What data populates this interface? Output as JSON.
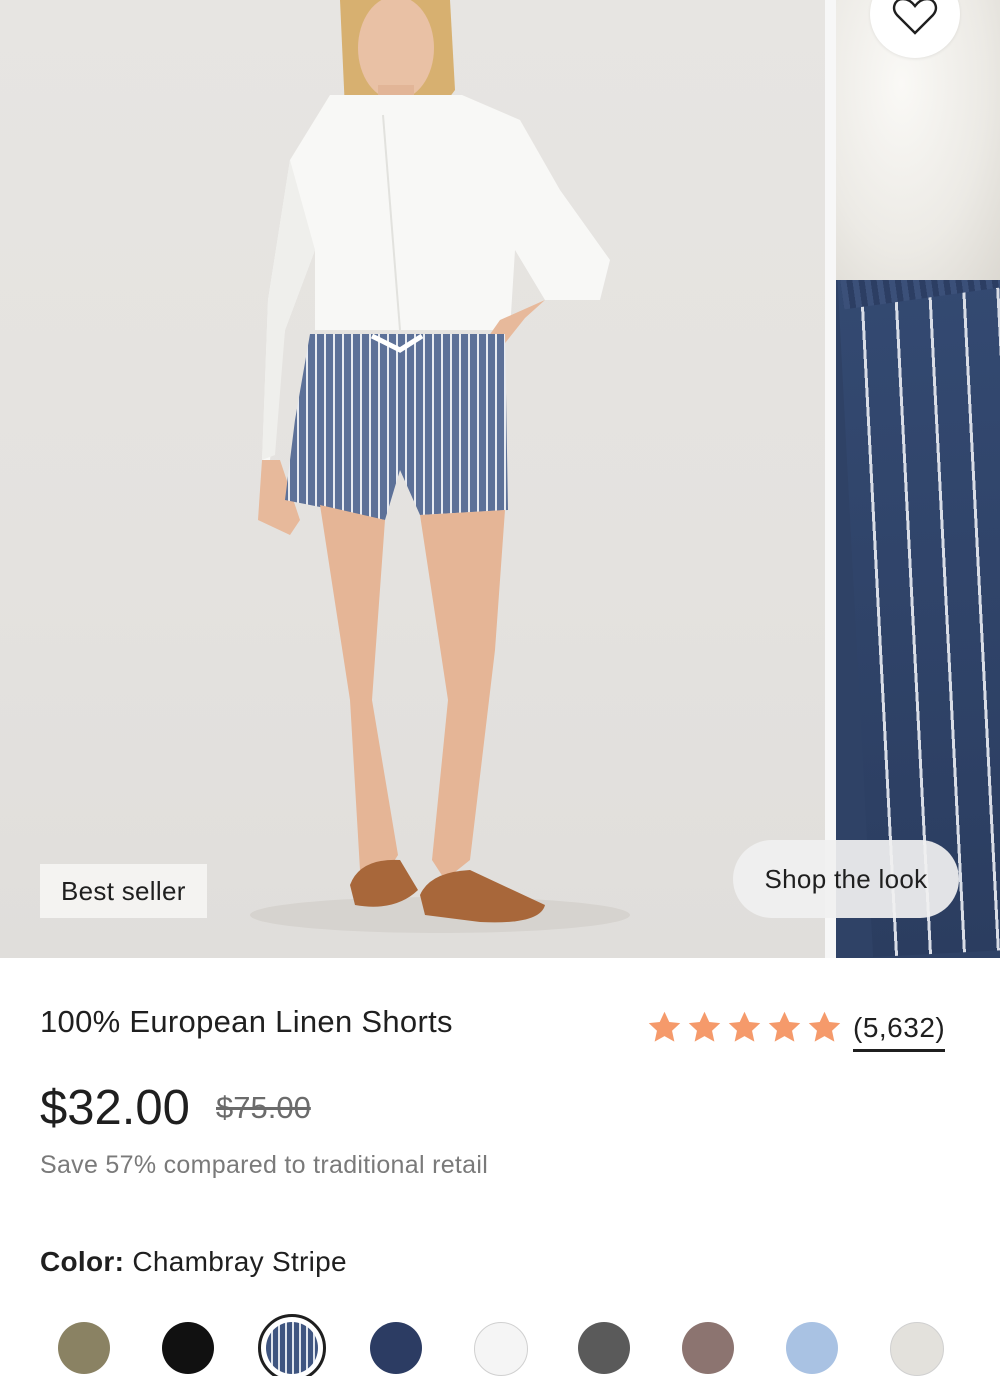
{
  "gallery": {
    "badge": "Best seller",
    "shop_the_look": "Shop the look"
  },
  "product": {
    "title": "100% European Linen Shorts",
    "rating": 5,
    "review_count": "(5,632)",
    "price": "$32.00",
    "compare_price": "$75.00",
    "savings_text": "Save 57% compared to traditional retail",
    "color_label": "Color:",
    "color_value": "Chambray Stripe"
  },
  "colors": {
    "star": "#f59a6b",
    "text": "#1f1f1f",
    "muted": "#7a7a7a"
  },
  "swatches": [
    {
      "name": "olive",
      "color": "#8a8263",
      "selected": false
    },
    {
      "name": "black",
      "color": "#111111",
      "selected": false
    },
    {
      "name": "chambray-stripe",
      "color": "#3f5580",
      "selected": true
    },
    {
      "name": "navy",
      "color": "#2c3c63",
      "selected": false
    },
    {
      "name": "white",
      "color": "#f5f5f5",
      "selected": false
    },
    {
      "name": "plaid",
      "color": "#5a5a5a",
      "selected": false
    },
    {
      "name": "check",
      "color": "#8c7470",
      "selected": false
    },
    {
      "name": "light-blue",
      "color": "#a9c2e3",
      "selected": false
    },
    {
      "name": "light-gray",
      "color": "#e3e1dc",
      "selected": false
    }
  ]
}
